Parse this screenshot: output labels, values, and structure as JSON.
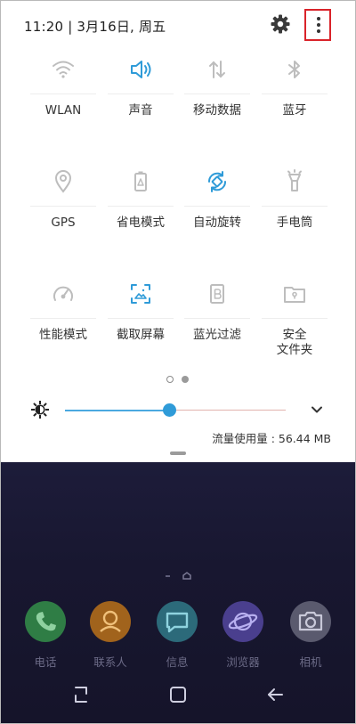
{
  "status_bar": {
    "time_date": "11:20 | 3月16日, 周五"
  },
  "quick_tiles": [
    {
      "label": "WLAN",
      "icon": "wifi-icon",
      "active": false
    },
    {
      "label": "声音",
      "icon": "volume-icon",
      "active": true
    },
    {
      "label": "移动数据",
      "icon": "mobile-data-icon",
      "active": false
    },
    {
      "label": "蓝牙",
      "icon": "bluetooth-icon",
      "active": false
    },
    {
      "label": "GPS",
      "icon": "location-pin-icon",
      "active": false
    },
    {
      "label": "省电模式",
      "icon": "battery-saver-icon",
      "active": false
    },
    {
      "label": "自动旋转",
      "icon": "auto-rotate-icon",
      "active": true
    },
    {
      "label": "手电筒",
      "icon": "flashlight-icon",
      "active": false
    },
    {
      "label": "性能模式",
      "icon": "speedometer-icon",
      "active": false
    },
    {
      "label": "截取屏幕",
      "icon": "screenshot-icon",
      "active": true
    },
    {
      "label": "蓝光过滤",
      "icon": "blue-light-filter-icon",
      "active": false
    },
    {
      "label": "安全\n文件夹",
      "icon": "secure-folder-icon",
      "active": false
    }
  ],
  "pager": {
    "count": 2,
    "current": 1
  },
  "brightness": {
    "level_fraction": 0.47
  },
  "data_usage": "流量使用量 : 56.44 MB",
  "dock": [
    {
      "label": "电话",
      "icon": "phone-icon",
      "color": "#2f7d45"
    },
    {
      "label": "联系人",
      "icon": "contacts-icon",
      "color": "#a1631c"
    },
    {
      "label": "信息",
      "icon": "messages-icon",
      "color": "#2c6a7a"
    },
    {
      "label": "浏览器",
      "icon": "browser-icon",
      "color": "#4a3f8e"
    },
    {
      "label": "相机",
      "icon": "camera-icon",
      "color": "#5a5a6e"
    }
  ],
  "colors": {
    "accent": "#2f9bd8",
    "highlight_box": "#d9232a"
  }
}
